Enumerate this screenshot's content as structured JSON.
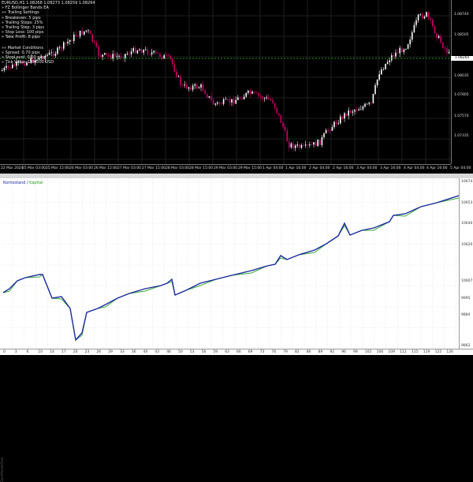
{
  "top_chart": {
    "info_lines": [
      "EURUSD,H1  1.08268 1.08273 1.08259 1.08264",
      "» FZ Bollinger Bands EA",
      "»» Trailing Settings",
      "» Breakeven: 5 pips",
      "» Trailing Stops: 25%",
      "» Trailing Step: 3 pips",
      "» Stop Loss: 100 pips",
      "» Take Profit: 8 pips"
    ],
    "market_lines": [
      "»» Market Conditions",
      "» Spread: 0.70 pips",
      "» StopLevel: 0.00 pips",
      "» Tick Value: 1.00000 USD"
    ],
    "price_axis": [
      "1.08740",
      "1.08505",
      "1.08264",
      "1.08035",
      "1.07805",
      "1.07570",
      "1.07335"
    ],
    "current_price": "1.08264",
    "time_axis": [
      "22 Mar 2024",
      "25 Mar 03:00",
      "25 Mar 15:00",
      "26 Mar 03:00",
      "26 Mar 15:00",
      "27 Mar 03:00",
      "27 Mar 15:00",
      "28 Mar 03:00",
      "28 Mar 15:00",
      "29 Mar 03:00",
      "29 Mar 15:00",
      "1 Apr 04:00",
      "1 Apr 16:00",
      "2 Apr 04:00",
      "2 Apr 16:00",
      "3 Apr 04:00",
      "3 Apr 16:00",
      "4 Apr 04:00",
      "4 Apr 16:00",
      "5 Apr 04:00"
    ],
    "colors": {
      "bull": "#ffffff",
      "bear": "#c8006a",
      "grid": "#1e1e1e",
      "level": "#2db82d"
    }
  },
  "bottom_chart": {
    "legend_balance": "Kontostand",
    "legend_sep": " / ",
    "legend_equity": "Kapital",
    "y_axis": [
      "10674",
      "10653",
      "10640",
      "10620",
      "10607",
      "9995",
      "9884",
      "9862"
    ],
    "x_axis": [
      "0",
      "3",
      "6",
      "10",
      "14",
      "17",
      "20",
      "23",
      "26",
      "29",
      "33",
      "36",
      "40",
      "43",
      "46",
      "50",
      "53",
      "56",
      "59",
      "63",
      "66",
      "69",
      "73",
      "76",
      "79",
      "82",
      "86",
      "89",
      "92",
      "96",
      "99",
      "102",
      "106",
      "109",
      "112",
      "115",
      "119",
      "122",
      "126"
    ],
    "side_label": "ZeroMarketSize",
    "colors": {
      "balance": "#1a2a9c",
      "equity": "#3aa83a",
      "grid": "#dcdcdc"
    }
  }
}
